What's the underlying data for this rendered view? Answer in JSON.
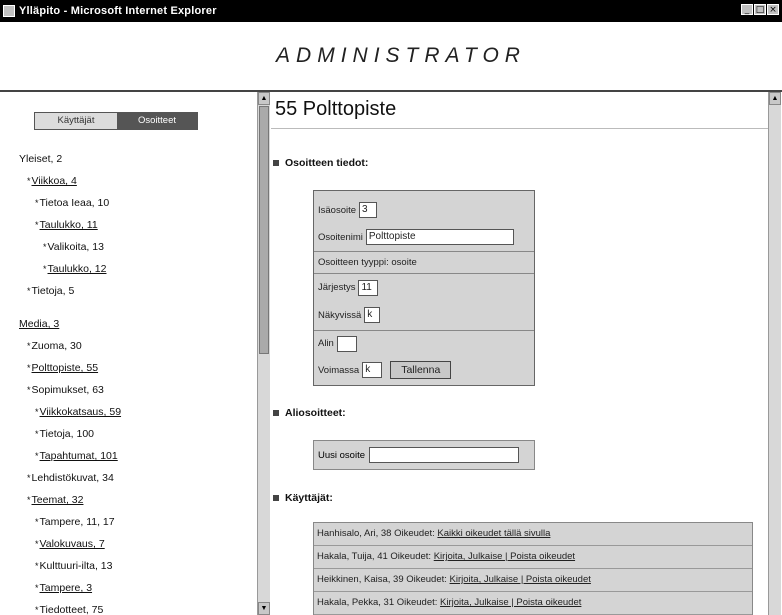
{
  "window": {
    "title": "Ylläpito - Microsoft Internet Explorer",
    "controls": [
      "_",
      "□",
      "×"
    ]
  },
  "header": {
    "title": "ADMINISTRATOR"
  },
  "tabs": [
    {
      "label": "Käyttäjät"
    },
    {
      "label": "Osoitteet"
    }
  ],
  "tree": [
    {
      "text": "Yleiset, 2",
      "level": 0,
      "link": false,
      "bullet": false
    },
    {
      "text": "Viikkoa, 4",
      "level": 1,
      "link": true,
      "bullet": true
    },
    {
      "text": "Tietoa Ieaa, 10",
      "level": 2,
      "link": false,
      "bullet": true
    },
    {
      "text": "Taulukko, 11",
      "level": 2,
      "link": true,
      "bullet": true
    },
    {
      "text": "Valikoita, 13",
      "level": 3,
      "link": false,
      "bullet": true
    },
    {
      "text": "Taulukko, 12",
      "level": 3,
      "link": true,
      "bullet": true
    },
    {
      "text": "Tietoja, 5",
      "level": 1,
      "link": false,
      "bullet": true
    },
    {
      "gap": true
    },
    {
      "text": "Media, 3",
      "level": 0,
      "link": true,
      "bullet": false
    },
    {
      "text": "Zuoma, 30",
      "level": 1,
      "link": false,
      "bullet": true
    },
    {
      "text": "Polttopiste, 55",
      "level": 1,
      "link": true,
      "bullet": true
    },
    {
      "text": "Sopimukset, 63",
      "level": 1,
      "link": false,
      "bullet": true
    },
    {
      "text": "Viikkokatsaus, 59",
      "level": 2,
      "link": true,
      "bullet": true
    },
    {
      "text": "Tietoja, 100",
      "level": 2,
      "link": false,
      "bullet": true
    },
    {
      "text": "Tapahtumat, 101",
      "level": 2,
      "link": true,
      "bullet": true
    },
    {
      "text": "Lehdistökuvat, 34",
      "level": 1,
      "link": false,
      "bullet": true
    },
    {
      "text": "Teemat, 32",
      "level": 1,
      "link": true,
      "bullet": true
    },
    {
      "text": "Tampere, 11, 17",
      "level": 2,
      "link": false,
      "bullet": true
    },
    {
      "text": "Valokuvaus, 7",
      "level": 2,
      "link": true,
      "bullet": true
    },
    {
      "text": "Kulttuuri-ilta, 13",
      "level": 2,
      "link": false,
      "bullet": true
    },
    {
      "text": "Tampere, 3",
      "level": 2,
      "link": true,
      "bullet": true
    },
    {
      "text": "Tiedotteet, 75",
      "level": 2,
      "link": false,
      "bullet": true
    }
  ],
  "page": {
    "title": "55 Polttopiste",
    "sections": {
      "details": "Osoitteen tiedot:",
      "aliases": "Aliosoitteet:",
      "users": "Käyttäjät:"
    },
    "form": {
      "parent_label": "Isäosoite",
      "parent_value": "3",
      "name_label": "Osoitenimi",
      "name_value": "Polttopiste",
      "type_label": "Osoitteen tyyppi: osoite",
      "type_value": "",
      "order_label": "Järjestys",
      "order_value": "11",
      "visible_label": "Näkyvissä",
      "visible_value": "k",
      "sub_label": "Alin",
      "sub_value": "",
      "date_label": "Voimassa",
      "date_value": "k",
      "save_button": "Tallenna"
    },
    "alias": {
      "label": "Uusi osoite",
      "value": ""
    },
    "users": [
      {
        "text": "Hanhisalo, Ari, 38 Oikeudet: ",
        "link": "Kaikki oikeudet tällä sivulla"
      },
      {
        "text": "Hakala, Tuija, 41 Oikeudet: ",
        "link": "Kirjoita, Julkaise | Poista oikeudet"
      },
      {
        "text": "Heikkinen, Kaisa, 39 Oikeudet: ",
        "link": "Kirjoita, Julkaise | Poista oikeudet"
      },
      {
        "text": "Hakala, Pekka, 31 Oikeudet: ",
        "link": "Kirjoita, Julkaise | Poista oikeudet"
      }
    ]
  }
}
